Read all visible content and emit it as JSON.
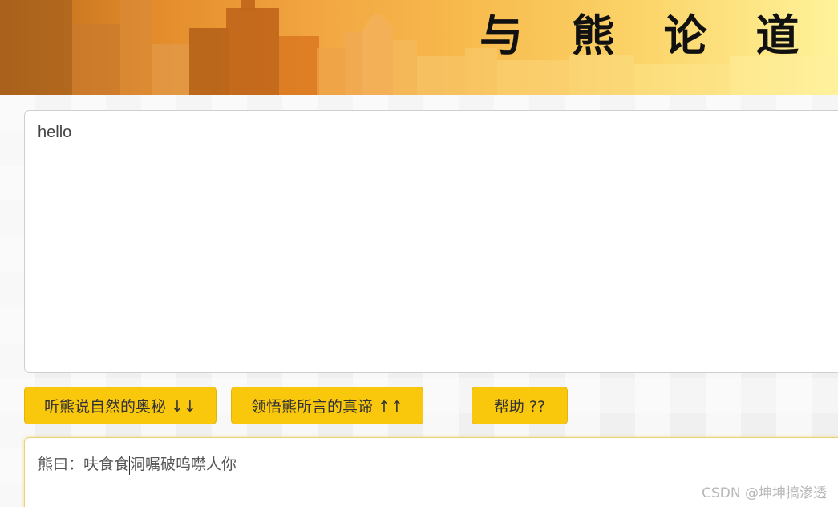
{
  "banner": {
    "title": "与 熊 论 道"
  },
  "input": {
    "value": "hello"
  },
  "buttons": {
    "listen_label": "听熊说自然的奥秘 ↓↓",
    "understand_label": "领悟熊所言的真谛 ↑↑",
    "help_label": "帮助 ??"
  },
  "output": {
    "value_before_caret": "熊曰：呋食食",
    "value_after_caret": "洞嘱破呜噤人你"
  },
  "watermark": {
    "text": "CSDN @坤坤搞渗透"
  },
  "colors": {
    "button_yellow": "#f9c70c",
    "banner_orange": "#e38b2a",
    "banner_light": "#fff39a"
  }
}
